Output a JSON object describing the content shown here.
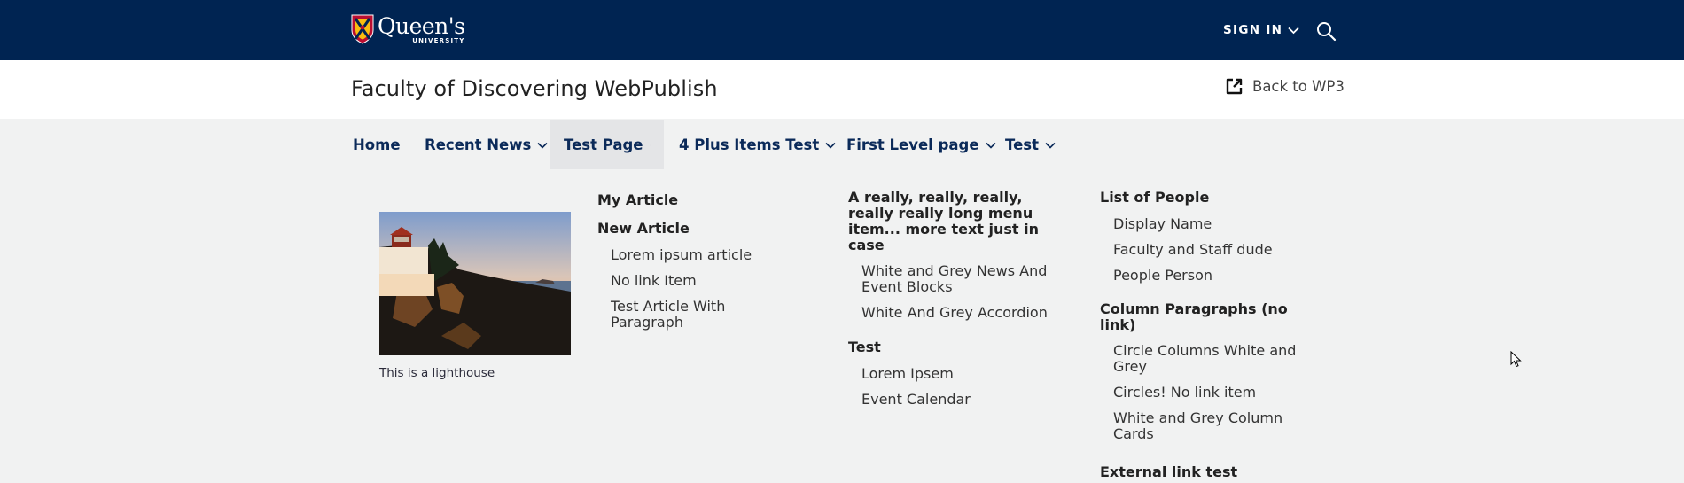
{
  "header": {
    "logo_name": "Queen's",
    "logo_sub": "UNIVERSITY",
    "signin_label": "SIGN IN",
    "search_icon": "search-icon",
    "brand_color": "#002452"
  },
  "titlebar": {
    "site_title": "Faculty of Discovering WebPublish",
    "back_link_label": "Back to WP3",
    "back_link_icon": "external-link-icon"
  },
  "nav": {
    "items": [
      {
        "label": "Home",
        "has_dropdown": false,
        "active": false
      },
      {
        "label": "Recent News",
        "has_dropdown": true,
        "active": false
      },
      {
        "label": "Test Page",
        "has_dropdown": true,
        "active": true
      },
      {
        "label": "4 Plus Items Test",
        "has_dropdown": true,
        "active": false
      },
      {
        "label": "First Level page",
        "has_dropdown": true,
        "active": false
      },
      {
        "label": "Test",
        "has_dropdown": true,
        "active": false
      }
    ]
  },
  "mega_menu": {
    "image_caption": "This is a lighthouse",
    "columns": [
      {
        "groups": [
          {
            "heading": "My Article",
            "items": []
          },
          {
            "heading": "New Article",
            "items": [
              "Lorem ipsum article",
              "No link Item",
              "Test Article With Paragraph"
            ]
          }
        ]
      },
      {
        "groups": [
          {
            "heading": "A really, really, really, really really long menu item... more text just in case",
            "items": [
              "White and Grey News And Event Blocks",
              "White And Grey Accordion"
            ]
          },
          {
            "heading": "Test",
            "items": [
              "Lorem Ipsem",
              "Event Calendar"
            ]
          }
        ]
      },
      {
        "groups": [
          {
            "heading": "List of People",
            "items": [
              "Display Name",
              "Faculty and Staff dude",
              "People Person"
            ]
          },
          {
            "heading": "Column Paragraphs (no link)",
            "items": [
              "Circle Columns White and Grey",
              "Circles! No link item",
              "White and Grey Column Cards"
            ]
          },
          {
            "heading": "External link test",
            "items": []
          }
        ]
      }
    ]
  }
}
